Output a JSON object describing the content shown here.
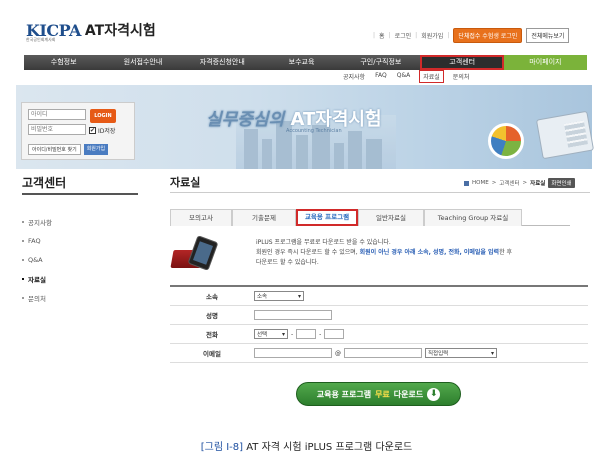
{
  "brand": {
    "logo_mark": "KICPA",
    "logo_sub": "한국공인회계사회",
    "title": "AT자격시험"
  },
  "top_links": {
    "home": "홈",
    "login": "로그인",
    "join": "회원가입",
    "group_login": "단체접수 수험생 로그인",
    "all_menu": "전체메뉴보기"
  },
  "main_nav": [
    "수험정보",
    "원서접수안내",
    "자격증신청안내",
    "보수교육",
    "구인/구직정보",
    "고객센터",
    "마이페이지"
  ],
  "sub_nav": [
    "공지사항",
    "FAQ",
    "Q&A",
    "자료실",
    "문의처"
  ],
  "banner": {
    "title_cursive": "실무중심의",
    "title_main": "AT자격시험",
    "subtitle": "Accounting Technician"
  },
  "login": {
    "id_placeholder": "아이디",
    "pw_placeholder": "비밀번호",
    "login_button": "LOGIN",
    "save_id_label": "ID저장",
    "find_link": "아이디/비밀번호 찾기",
    "join_link": "회원가입"
  },
  "sidebar": {
    "title": "고객센터",
    "items": [
      "공지사항",
      "FAQ",
      "Q&A",
      "자료실",
      "문의처"
    ],
    "active_index": 3
  },
  "content": {
    "title": "자료실",
    "breadcrumb": [
      "HOME",
      "고객센터",
      "자료실"
    ],
    "print_button": "화면인쇄"
  },
  "tabs": [
    "모의고사",
    "기출문제",
    "교육용 프로그램",
    "일반자료실",
    "Teaching Group 자료실"
  ],
  "intro": {
    "line1": "iPLUS 프로그램을 무료로 다운로드 받을 수 있습니다.",
    "line2_pre": "회원인 경우 즉시 다운로드 할 수 있으며, ",
    "line2_highlight": "회원이 아닌 경우 아래 소속, 성명, 전화, 이메일을 입력",
    "line2_post": "한 후",
    "line3": "다운로드 할 수 있습니다."
  },
  "form": {
    "affiliation_label": "소속",
    "affiliation_value": "소속",
    "name_label": "성명",
    "phone_label": "전화",
    "phone_select": "선택",
    "phone_dash": "-",
    "email_label": "이메일",
    "email_at": "@",
    "email_domain_select": "직접입력"
  },
  "download": {
    "pre": "교육용 프로그램 ",
    "highlight": "무료",
    "post": " 다운로드"
  },
  "caption": {
    "figure": "[그림 Ⅰ-8]",
    "text": " AT 자격 시험 iPLUS 프로그램 다운로드"
  },
  "colors": {
    "nav_active_border": "#d12a2a",
    "mypage_green": "#7bb33a",
    "download_green": "#2d7e2d",
    "link_blue": "#2a5fb5"
  }
}
